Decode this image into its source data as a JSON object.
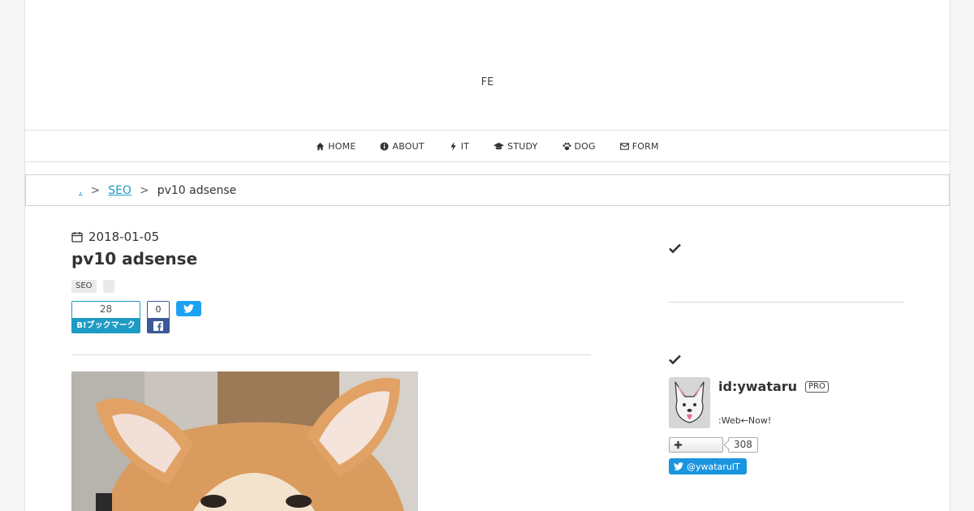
{
  "site": {
    "title": "FE"
  },
  "nav": {
    "items": [
      {
        "label": "HOME",
        "icon": "home-icon"
      },
      {
        "label": "ABOUT",
        "icon": "info-icon"
      },
      {
        "label": "IT",
        "icon": "bolt-icon"
      },
      {
        "label": "STUDY",
        "icon": "graduation-cap-icon"
      },
      {
        "label": "DOG",
        "icon": "paw-icon"
      },
      {
        "label": "FORM",
        "icon": "envelope-icon"
      }
    ]
  },
  "breadcrumb": {
    "home": ".",
    "category": "SEO",
    "current": "pv10 adsense",
    "separator": ">"
  },
  "article": {
    "date": "2018-01-05",
    "title": "pv10 adsense",
    "tags": [
      "SEO"
    ],
    "hatena_count": "28",
    "hatena_label": "B!ブックマーク",
    "facebook_count": "0"
  },
  "profile": {
    "user_id": "id:ywataru",
    "badge": "PRO",
    "description": ":Web←Now!",
    "subscriber_count": "308",
    "twitter_handle": "@ywataruIT"
  },
  "colors": {
    "accent": "#1e9bc4",
    "facebook": "#3b5998",
    "twitter": "#1da1f2"
  }
}
